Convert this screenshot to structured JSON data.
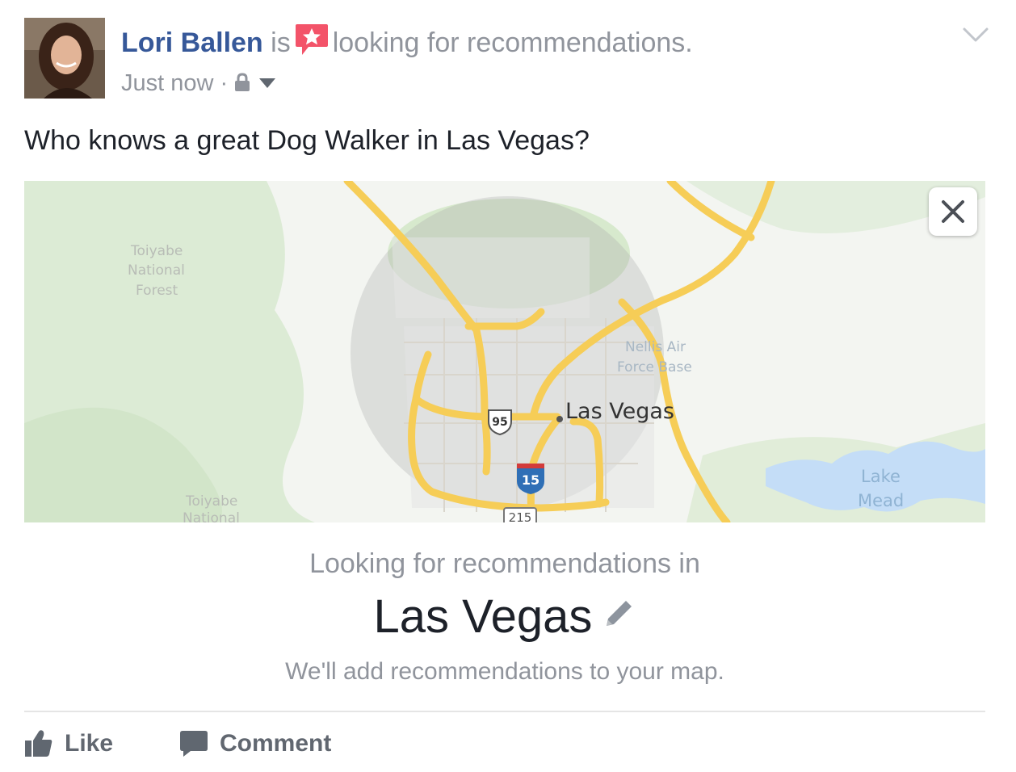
{
  "post": {
    "author": "Lori Ballen",
    "verb": "is",
    "activity": "looking for recommendations.",
    "timestamp": "Just now",
    "separator": "·",
    "text": "Who knows a great Dog Walker in Las Vegas?",
    "icons": {
      "activity": "recommendation-star-icon",
      "privacy": "lock-icon",
      "audience": "caret-down-icon",
      "menu": "chevron-down-icon"
    }
  },
  "map": {
    "city_label": "Las Vegas",
    "area_labels": [
      "Toiyabe National Forest",
      "Toiyabe National",
      "Nellis Air Force Base",
      "Lake Mead"
    ],
    "area_label_lines": {
      "forest_north": [
        "Toiyabe",
        "National",
        "Forest"
      ],
      "forest_south": [
        "Toiyabe",
        "National"
      ],
      "nellis": [
        "Nellis Air",
        "Force Base"
      ],
      "lake": [
        "Lake",
        "Mead"
      ]
    },
    "route_shields": [
      "95",
      "15",
      "215"
    ],
    "close_icon": "close-icon",
    "colors": {
      "land": "#f3f5f1",
      "forest": "#dcebd5",
      "radius": "#a9a9a9",
      "roads": "#f6cd57",
      "water": "#c4ddf7"
    }
  },
  "recommendation": {
    "prompt": "Looking for recommendations in",
    "location": "Las Vegas",
    "note": "We'll add recommendations to your map.",
    "edit_icon": "pencil-icon"
  },
  "actions": {
    "like": "Like",
    "comment": "Comment",
    "like_icon": "thumbs-up-icon",
    "comment_icon": "speech-bubble-icon"
  },
  "colors": {
    "link": "#365899",
    "secondary": "#90949c",
    "text": "#1d2129",
    "badge": "#f35369"
  }
}
